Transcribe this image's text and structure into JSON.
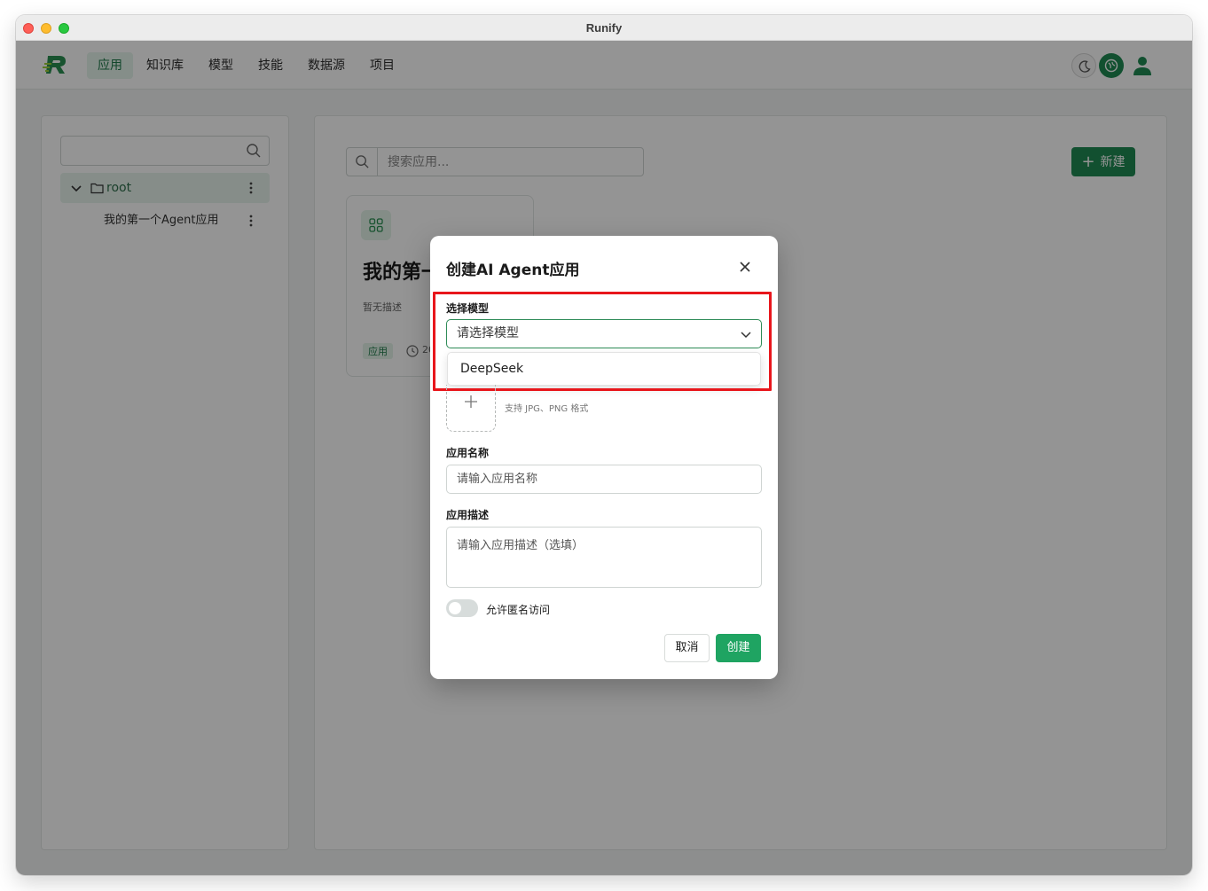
{
  "window": {
    "title": "Runify"
  },
  "nav": {
    "items": [
      {
        "label": "应用",
        "active": true
      },
      {
        "label": "知识库",
        "active": false
      },
      {
        "label": "模型",
        "active": false
      },
      {
        "label": "技能",
        "active": false
      },
      {
        "label": "数据源",
        "active": false
      },
      {
        "label": "项目",
        "active": false
      }
    ],
    "icons": [
      "moon-icon",
      "brain-icon",
      "user-icon"
    ]
  },
  "sidebar": {
    "search": {
      "value": "",
      "placeholder": ""
    },
    "tree": {
      "root_label": "root",
      "children": [
        {
          "label": "我的第一个Agent应用"
        }
      ]
    }
  },
  "main": {
    "search": {
      "placeholder": "搜索应用..."
    },
    "new_button": "新建",
    "card": {
      "title": "我的第一",
      "desc": "暂无描述",
      "tag": "应用",
      "date_prefix": "20"
    }
  },
  "modal": {
    "title": "创建AI Agent应用",
    "model_label": "选择模型",
    "model_placeholder": "请选择模型",
    "model_options": [
      "DeepSeek"
    ],
    "upload_hint": "支持 JPG、PNG 格式",
    "name_label": "应用名称",
    "name_placeholder": "请输入应用名称",
    "desc_label": "应用描述",
    "desc_placeholder": "请输入应用描述（选填）",
    "anonymous_label": "允许匿名访问",
    "anonymous_enabled": false,
    "cancel": "取消",
    "create": "创建"
  },
  "colors": {
    "brand": "#1f8a53",
    "highlight": "#e8161c"
  }
}
